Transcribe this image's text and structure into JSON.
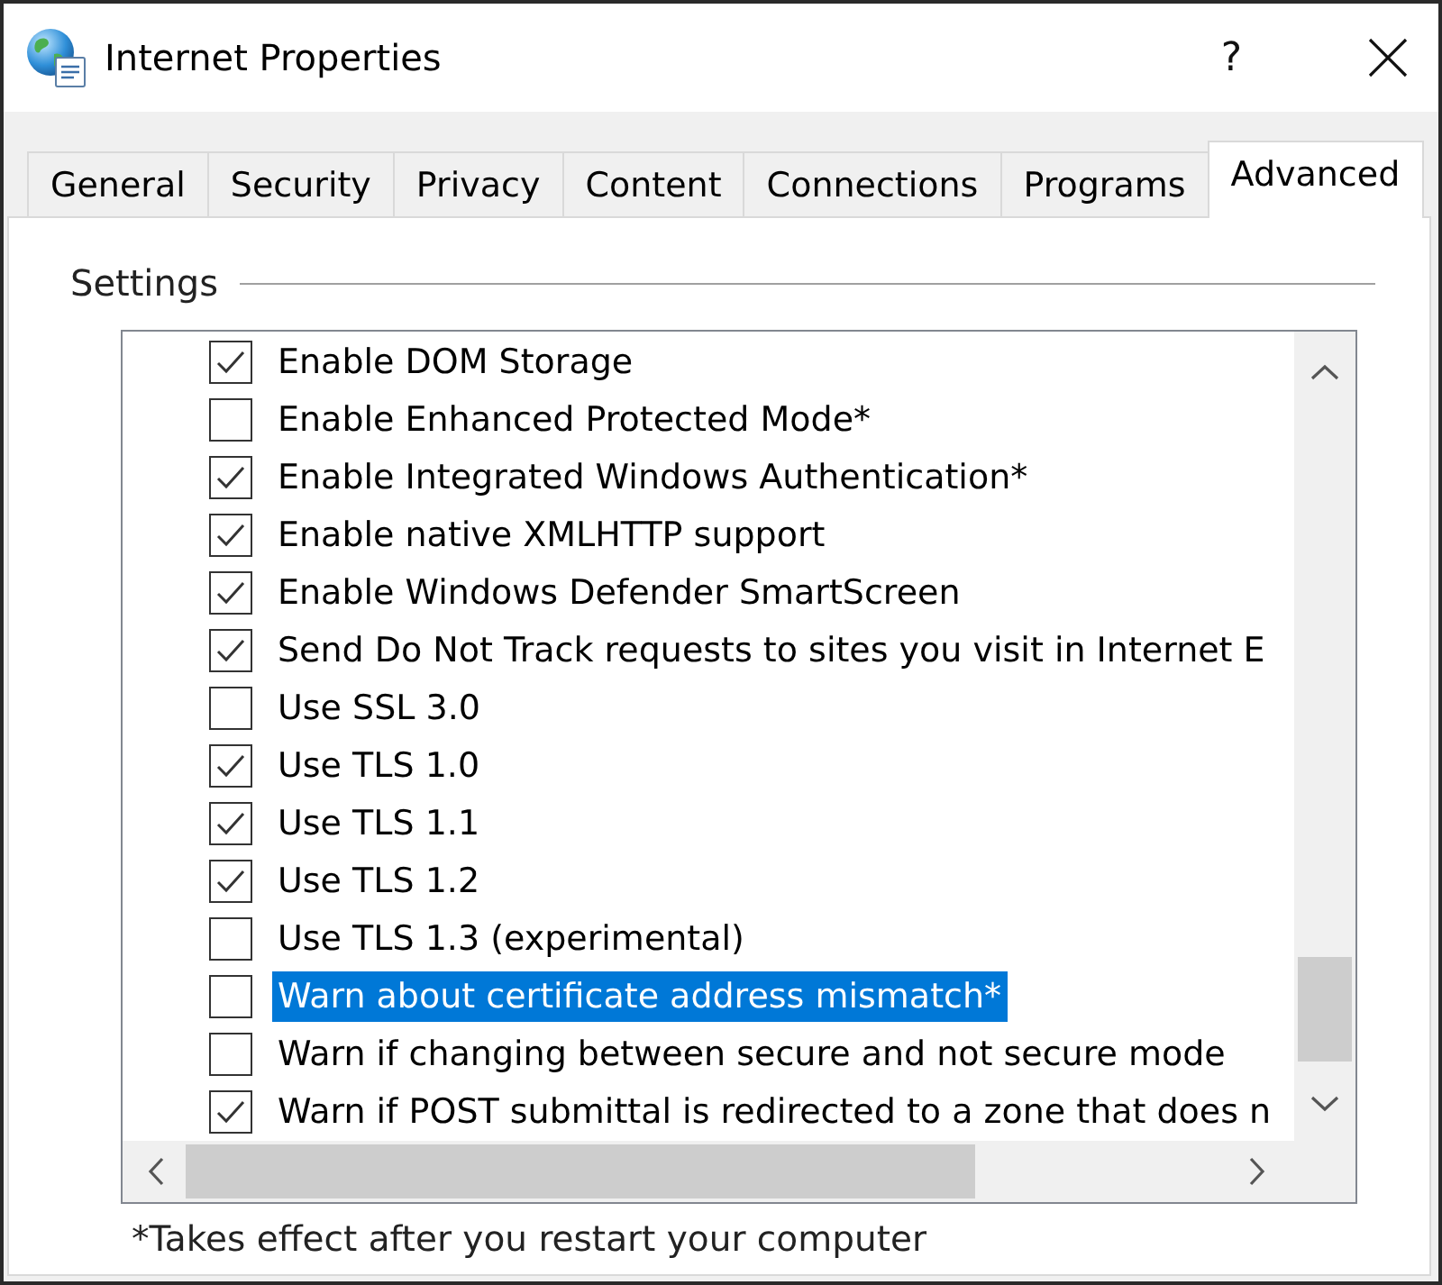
{
  "window": {
    "title": "Internet Properties",
    "help_button": "?"
  },
  "tabs": [
    {
      "label": "General",
      "selected": false
    },
    {
      "label": "Security",
      "selected": false
    },
    {
      "label": "Privacy",
      "selected": false
    },
    {
      "label": "Content",
      "selected": false
    },
    {
      "label": "Connections",
      "selected": false
    },
    {
      "label": "Programs",
      "selected": false
    },
    {
      "label": "Advanced",
      "selected": true
    }
  ],
  "settings": {
    "label": "Settings",
    "rows": [
      {
        "label": "Enable DOM Storage",
        "checked": true,
        "selected": false
      },
      {
        "label": "Enable Enhanced Protected Mode*",
        "checked": false,
        "selected": false
      },
      {
        "label": "Enable Integrated Windows Authentication*",
        "checked": true,
        "selected": false
      },
      {
        "label": "Enable native XMLHTTP support",
        "checked": true,
        "selected": false
      },
      {
        "label": "Enable Windows Defender SmartScreen",
        "checked": true,
        "selected": false
      },
      {
        "label": "Send Do Not Track requests to sites you visit in Internet E",
        "checked": true,
        "selected": false
      },
      {
        "label": "Use SSL 3.0",
        "checked": false,
        "selected": false
      },
      {
        "label": "Use TLS 1.0",
        "checked": true,
        "selected": false
      },
      {
        "label": "Use TLS 1.1",
        "checked": true,
        "selected": false
      },
      {
        "label": "Use TLS 1.2",
        "checked": true,
        "selected": false
      },
      {
        "label": "Use TLS 1.3 (experimental)",
        "checked": false,
        "selected": false
      },
      {
        "label": "Warn about certificate address mismatch*",
        "checked": false,
        "selected": true
      },
      {
        "label": "Warn if changing between secure and not secure mode",
        "checked": false,
        "selected": false
      },
      {
        "label": "Warn if POST submittal is redirected to a zone that does n",
        "checked": true,
        "selected": false
      }
    ]
  },
  "footnote": "*Takes effect after you restart your computer"
}
